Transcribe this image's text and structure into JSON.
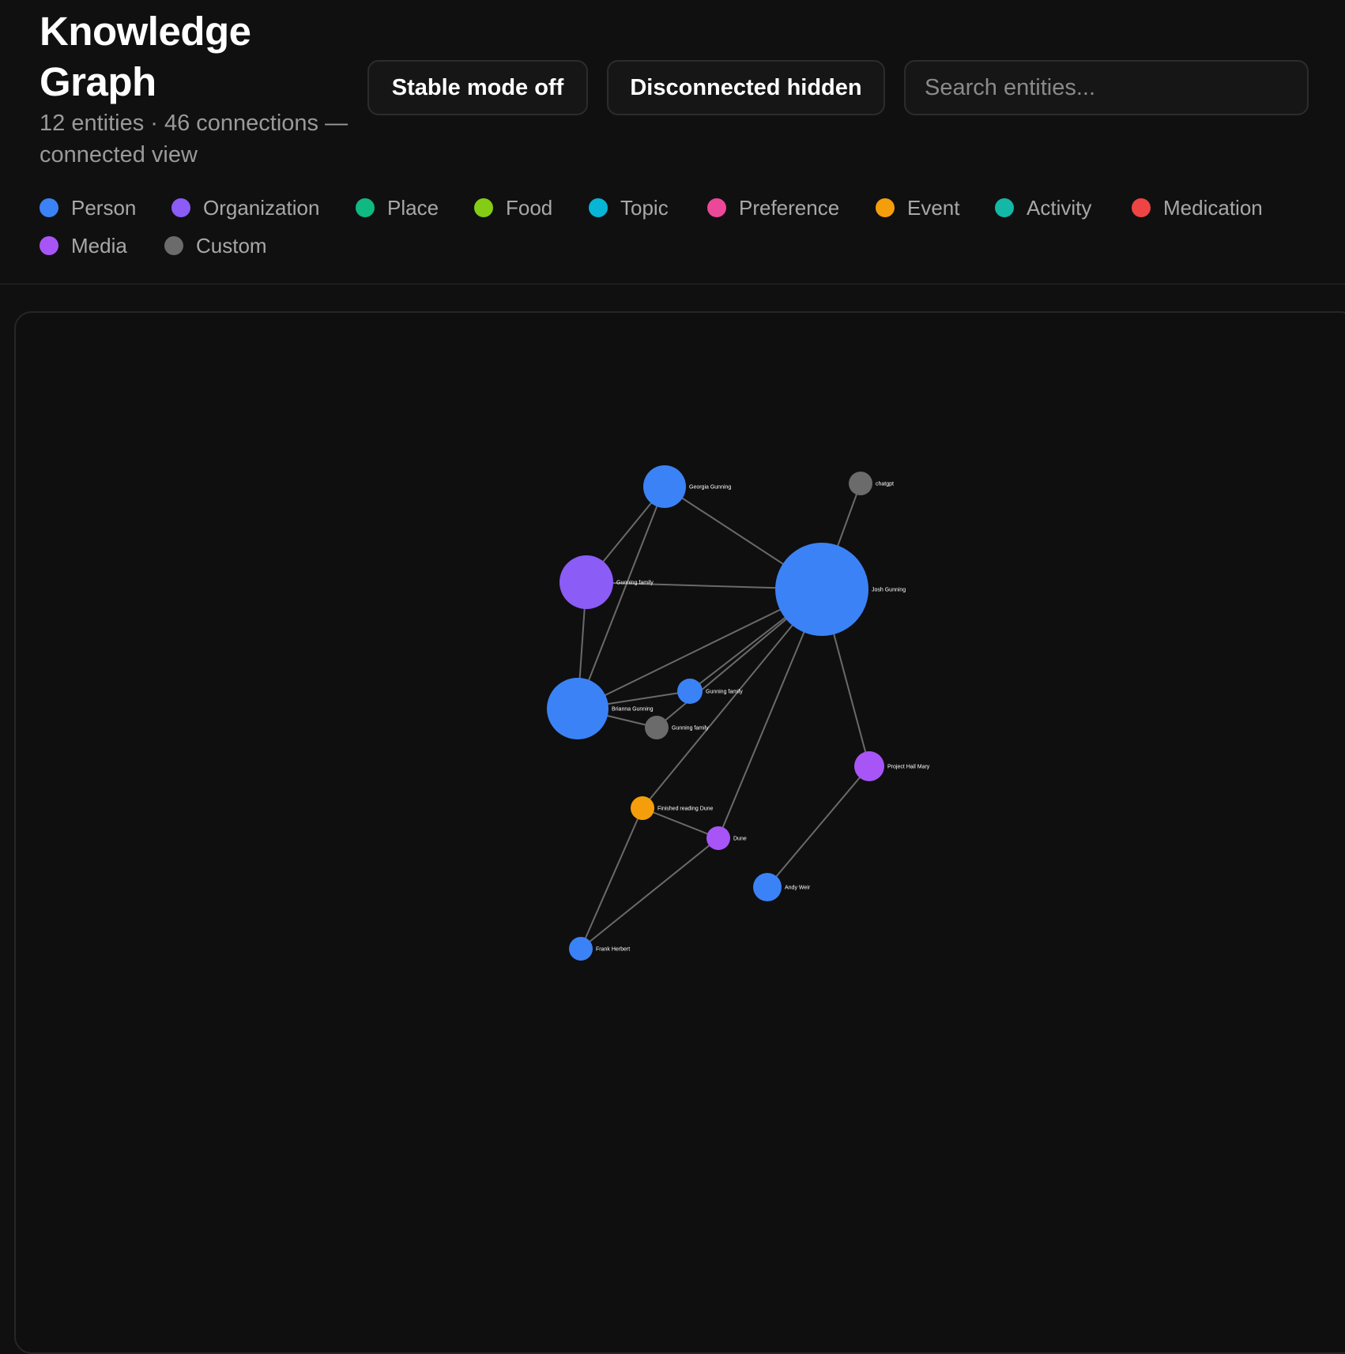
{
  "header": {
    "title": "Knowledge Graph",
    "subtitle": "12 entities · 46 connections — connected view",
    "stable_mode_label": "Stable mode off",
    "disconnected_label": "Disconnected hidden",
    "search_placeholder": "Search entities...",
    "search_value": ""
  },
  "legend": [
    {
      "label": "Person",
      "color": "#3b82f6"
    },
    {
      "label": "Organization",
      "color": "#8b5cf6"
    },
    {
      "label": "Place",
      "color": "#10b981"
    },
    {
      "label": "Food",
      "color": "#84cc16"
    },
    {
      "label": "Topic",
      "color": "#06b6d4"
    },
    {
      "label": "Preference",
      "color": "#ec4899"
    },
    {
      "label": "Event",
      "color": "#f59e0b"
    },
    {
      "label": "Activity",
      "color": "#14b8a6"
    },
    {
      "label": "Medication",
      "color": "#ef4444"
    },
    {
      "label": "Media",
      "color": "#a855f7"
    },
    {
      "label": "Custom",
      "color": "#6b6b6b"
    }
  ],
  "graph": {
    "nodes": [
      {
        "id": "georgia",
        "label": "Georgia Gunning",
        "type": "Person"
      },
      {
        "id": "chatgpt",
        "label": "chatgpt",
        "type": "Custom"
      },
      {
        "id": "gfam_org",
        "label": "Gunning family",
        "type": "Organization"
      },
      {
        "id": "josh",
        "label": "Josh Gunning",
        "type": "Person"
      },
      {
        "id": "brianna",
        "label": "Brianna Gunning",
        "type": "Person"
      },
      {
        "id": "gfam_person",
        "label": "Gunning family",
        "type": "Person"
      },
      {
        "id": "gfam_custom",
        "label": "Gunning family",
        "type": "Custom"
      },
      {
        "id": "phm",
        "label": "Project Hail Mary",
        "type": "Media"
      },
      {
        "id": "frd",
        "label": "Finished reading Dune",
        "type": "Event"
      },
      {
        "id": "dune",
        "label": "Dune",
        "type": "Media"
      },
      {
        "id": "andy",
        "label": "Andy Weir",
        "type": "Person"
      },
      {
        "id": "frank",
        "label": "Frank Herbert",
        "type": "Person"
      }
    ],
    "edges": [
      {
        "source": "georgia",
        "target": "gfam_org"
      },
      {
        "source": "georgia",
        "target": "josh"
      },
      {
        "source": "georgia",
        "target": "brianna"
      },
      {
        "source": "gfam_org",
        "target": "josh"
      },
      {
        "source": "gfam_org",
        "target": "brianna"
      },
      {
        "source": "chatgpt",
        "target": "josh"
      },
      {
        "source": "josh",
        "target": "brianna"
      },
      {
        "source": "josh",
        "target": "gfam_person"
      },
      {
        "source": "josh",
        "target": "gfam_custom"
      },
      {
        "source": "josh",
        "target": "phm"
      },
      {
        "source": "josh",
        "target": "frd"
      },
      {
        "source": "josh",
        "target": "dune"
      },
      {
        "source": "brianna",
        "target": "gfam_person"
      },
      {
        "source": "brianna",
        "target": "gfam_custom"
      },
      {
        "source": "phm",
        "target": "andy"
      },
      {
        "source": "frd",
        "target": "dune"
      },
      {
        "source": "frd",
        "target": "frank"
      },
      {
        "source": "dune",
        "target": "frank"
      }
    ]
  }
}
